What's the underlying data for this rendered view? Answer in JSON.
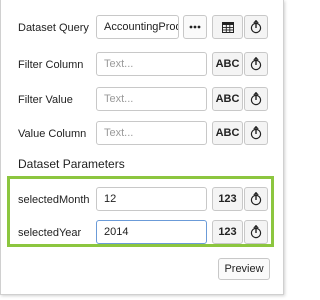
{
  "fields": {
    "dataset_query": {
      "label": "Dataset Query",
      "value": "AccountingProd",
      "more_icon": "ellipsis-icon",
      "type_icon": "table-grid-icon",
      "pin_icon": "pin-icon"
    },
    "filter_column": {
      "label": "Filter Column",
      "placeholder": "Text...",
      "type_label": "ABC",
      "pin_icon": "pin-icon"
    },
    "filter_value": {
      "label": "Filter Value",
      "placeholder": "Text...",
      "type_label": "ABC",
      "pin_icon": "pin-icon"
    },
    "value_column": {
      "label": "Value Column",
      "placeholder": "Text...",
      "type_label": "ABC",
      "pin_icon": "pin-icon"
    }
  },
  "dataset_parameters": {
    "title": "Dataset Parameters",
    "highlight_color": "#8cc63f",
    "params": [
      {
        "label": "selectedMonth",
        "value": "12",
        "type_label": "123",
        "pin_icon": "pin-icon"
      },
      {
        "label": "selectedYear",
        "value": "2014",
        "type_label": "123",
        "pin_icon": "pin-icon"
      }
    ]
  },
  "footer": {
    "preview_label": "Preview"
  }
}
